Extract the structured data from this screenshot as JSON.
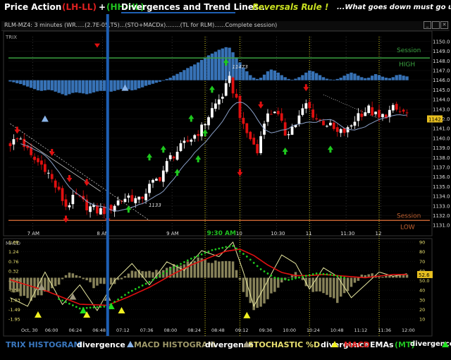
{
  "header": {
    "price_action": "Price Action",
    "lh_ll": "(LH-LL)",
    "plus": "+",
    "hh_hl": "(HH-HL)",
    "divergences": "Divergences and Trend Lines...",
    "reversals": "Reversals Rule !",
    "tagline": "...What goes down must go up"
  },
  "window": {
    "caption": "RLM-MZ4: 3 minutes (WR.....(2.7E-05,T5)...(STO+MACDx)........(TL for RLM)......Complete session)",
    "trix_label": "TRIX",
    "macd_label": "MACD"
  },
  "colors": {
    "bull": "#ffffff",
    "bear": "#e01010",
    "trix": "#3a78c0",
    "macd_hist": "#a09a6a",
    "stoch": "#e8e8a0",
    "blue_line": "#1e5fb4",
    "green": "#1ec81e",
    "red": "#e01010",
    "session_high": "#3aa040",
    "session_low": "#c06030"
  },
  "chart_data": [
    {
      "type": "candlestick",
      "name": "price",
      "y_ticks": [
        1131.0,
        1132.0,
        1133.0,
        1134.0,
        1135.0,
        1136.0,
        1137.0,
        1138.0,
        1139.0,
        1140.0,
        1141.0,
        1142.0,
        1143.0,
        1144.0,
        1145.0,
        1146.0,
        1147.0,
        1148.0,
        1149.0,
        1150.0
      ],
      "ylim": [
        1130.5,
        1150.5
      ],
      "x_labels": [
        "7 AM",
        "8 AM",
        "9 AM",
        "9:30 AM",
        "10",
        "10:30",
        "11",
        "11:30",
        "12"
      ],
      "x_label_pos": [
        6.5,
        26.5,
        46.5,
        56.5,
        66.5,
        76.5,
        86.5,
        96.5,
        106.5
      ],
      "bar_count": 115,
      "close_path": [
        [
          0,
          1139.5
        ],
        [
          3,
          1140.0
        ],
        [
          6,
          1138.0
        ],
        [
          10,
          1137.0
        ],
        [
          13,
          1135.0
        ],
        [
          16,
          1133.0
        ],
        [
          19,
          1134.0
        ],
        [
          22,
          1133.0
        ],
        [
          25,
          1132.5
        ],
        [
          28,
          1132.5
        ],
        [
          31,
          1133.5
        ],
        [
          34,
          1134.0
        ],
        [
          37,
          1133.5
        ],
        [
          40,
          1135.0
        ],
        [
          43,
          1136.0
        ],
        [
          46,
          1138.0
        ],
        [
          49,
          1139.0
        ],
        [
          52,
          1140.0
        ],
        [
          55,
          1141.0
        ],
        [
          58,
          1143.0
        ],
        [
          61,
          1144.5
        ],
        [
          63,
          1146.0
        ],
        [
          65,
          1144.0
        ],
        [
          67,
          1141.0
        ],
        [
          69,
          1140.0
        ],
        [
          71,
          1138.5
        ],
        [
          73,
          1142.0
        ],
        [
          76,
          1143.0
        ],
        [
          79,
          1140.5
        ],
        [
          82,
          1141.5
        ],
        [
          85,
          1143.5
        ],
        [
          88,
          1142.0
        ],
        [
          91,
          1141.5
        ],
        [
          94,
          1140.5
        ],
        [
          97,
          1140.8
        ],
        [
          100,
          1142.5
        ],
        [
          103,
          1143.0
        ],
        [
          106,
          1142.0
        ],
        [
          110,
          1143.0
        ],
        [
          114,
          1142.5
        ]
      ],
      "session_high": {
        "label1": "Session",
        "label2": "HIGH",
        "value": 1148.3
      },
      "session_low": {
        "label1": "Session",
        "label2": "LOW",
        "value": 1131.5
      },
      "annotations": [
        {
          "text": "11473",
          "at": 65,
          "value": 1147.2
        },
        {
          "text": "1133",
          "at": 41,
          "value": 1132.9
        }
      ],
      "last_price": "1142.0",
      "vertical_markers": [
        56,
        66,
        86,
        106
      ],
      "blue_line_at": 28,
      "signals": [
        {
          "kind": "red-down",
          "at": 2,
          "value": 1140.9
        },
        {
          "kind": "red-down",
          "at": 12,
          "value": 1138.6
        },
        {
          "kind": "red-down",
          "at": 17,
          "value": 1135.9
        },
        {
          "kind": "red-down",
          "at": 22,
          "value": 1135.5
        },
        {
          "kind": "red-down",
          "at": 16,
          "value": 1131.7
        },
        {
          "kind": "red-down",
          "at": 28,
          "value": 1131.7
        },
        {
          "kind": "green-up",
          "at": 34,
          "value": 1132.6
        },
        {
          "kind": "green-up",
          "at": 40,
          "value": 1138.0
        },
        {
          "kind": "green-up",
          "at": 44,
          "value": 1138.8
        },
        {
          "kind": "green-up",
          "at": 48,
          "value": 1136.4
        },
        {
          "kind": "green-up",
          "at": 54,
          "value": 1137.8
        },
        {
          "kind": "green-up",
          "at": 52,
          "value": 1142.0
        },
        {
          "kind": "green-up",
          "at": 56,
          "value": 1140.5
        },
        {
          "kind": "green-up",
          "at": 58,
          "value": 1145.0
        },
        {
          "kind": "green-up",
          "at": 62,
          "value": 1147.8
        },
        {
          "kind": "red-down",
          "at": 66,
          "value": 1136.5
        },
        {
          "kind": "red-down",
          "at": 72,
          "value": 1143.5
        },
        {
          "kind": "green-up",
          "at": 79,
          "value": 1138.6
        },
        {
          "kind": "red-down",
          "at": 85,
          "value": 1145.3
        },
        {
          "kind": "green-up",
          "at": 92,
          "value": 1138.8
        }
      ],
      "trix_triangles": [
        {
          "at": 10,
          "value": 1142.0
        },
        {
          "at": 33,
          "value": 1145.2
        }
      ]
    },
    {
      "type": "bar",
      "name": "TRIX histogram",
      "values": [
        -0.05,
        -0.08,
        -0.12,
        -0.15,
        -0.2,
        -0.25,
        -0.3,
        -0.35,
        -0.4,
        -0.42,
        -0.4,
        -0.38,
        -0.4,
        -0.45,
        -0.5,
        -0.55,
        -0.6,
        -0.55,
        -0.5,
        -0.48,
        -0.5,
        -0.52,
        -0.55,
        -0.52,
        -0.48,
        -0.44,
        -0.42,
        -0.42,
        -0.44,
        -0.45,
        -0.42,
        -0.38,
        -0.35,
        -0.33,
        -0.36,
        -0.4,
        -0.38,
        -0.32,
        -0.28,
        -0.22,
        -0.18,
        -0.14,
        -0.1,
        -0.06,
        -0.02,
        0.05,
        0.1,
        0.18,
        0.25,
        0.32,
        0.4,
        0.48,
        0.55,
        0.62,
        0.7,
        0.8,
        0.9,
        0.98,
        1.05,
        1.12,
        1.2,
        1.25,
        1.3,
        1.28,
        1.1,
        0.9,
        0.7,
        0.5,
        0.35,
        0.2,
        0.1,
        0.05,
        0.1,
        0.22,
        0.35,
        0.42,
        0.38,
        0.3,
        0.2,
        0.12,
        0.05,
        0.02,
        0.06,
        0.12,
        0.2,
        0.3,
        0.38,
        0.35,
        0.28,
        0.2,
        0.12,
        0.06,
        0.03,
        0.02,
        0.05,
        0.1,
        0.18,
        0.25,
        0.3,
        0.26,
        0.18,
        0.12,
        0.08,
        0.1,
        0.18,
        0.24,
        0.2,
        0.14,
        0.1,
        0.08,
        0.12,
        0.2,
        0.22,
        0.18,
        0.15
      ]
    },
    {
      "type": "line",
      "name": "MACD indicator",
      "y_ticks_left": [
        "1.68",
        "1.24",
        "0.76",
        "0.32",
        "-0.13",
        "-0.58",
        "-1.03",
        "-1.49",
        "-1.95"
      ],
      "y_ticks_right": [
        "90",
        "80",
        "70",
        "60",
        "50.0",
        "40",
        "30",
        "20",
        "10"
      ],
      "x_labels": [
        "Oct, 30",
        "06:00",
        "06:24",
        "06:48",
        "07:12",
        "07:36",
        "08:00",
        "08:24",
        "08:48",
        "09:12",
        "09:36",
        "10:00",
        "10:24",
        "10:48",
        "11:12",
        "11:36",
        "12:00"
      ],
      "ylim": [
        -1.95,
        1.68
      ],
      "histogram_anchors": [
        [
          0,
          -0.6
        ],
        [
          6,
          -1.0
        ],
        [
          12,
          -0.5
        ],
        [
          18,
          0.3
        ],
        [
          24,
          -0.4
        ],
        [
          30,
          -0.2
        ],
        [
          36,
          0.4
        ],
        [
          42,
          0.3
        ],
        [
          48,
          0.6
        ],
        [
          54,
          0.9
        ],
        [
          60,
          0.7
        ],
        [
          64,
          0.8
        ],
        [
          67,
          -0.6
        ],
        [
          70,
          -1.6
        ],
        [
          74,
          -1.0
        ],
        [
          78,
          -0.3
        ],
        [
          82,
          0.2
        ],
        [
          86,
          -0.5
        ],
        [
          90,
          -0.8
        ],
        [
          94,
          -1.1
        ],
        [
          98,
          -0.4
        ],
        [
          102,
          0.2
        ],
        [
          106,
          0.1
        ],
        [
          110,
          0.15
        ],
        [
          114,
          0.1
        ]
      ],
      "stoch_anchors": [
        [
          0,
          30
        ],
        [
          5,
          20
        ],
        [
          10,
          60
        ],
        [
          15,
          22
        ],
        [
          20,
          45
        ],
        [
          25,
          15
        ],
        [
          30,
          50
        ],
        [
          35,
          70
        ],
        [
          40,
          45
        ],
        [
          45,
          72
        ],
        [
          50,
          62
        ],
        [
          55,
          85
        ],
        [
          60,
          78
        ],
        [
          64,
          95
        ],
        [
          67,
          60
        ],
        [
          70,
          20
        ],
        [
          74,
          50
        ],
        [
          78,
          80
        ],
        [
          82,
          70
        ],
        [
          86,
          40
        ],
        [
          90,
          65
        ],
        [
          94,
          55
        ],
        [
          98,
          30
        ],
        [
          102,
          45
        ],
        [
          106,
          60
        ],
        [
          110,
          55
        ],
        [
          114,
          58
        ]
      ],
      "macd_anchors": [
        [
          0,
          -0.2
        ],
        [
          8,
          -0.5
        ],
        [
          14,
          -1.0
        ],
        [
          20,
          -1.45
        ],
        [
          28,
          -1.35
        ],
        [
          34,
          -0.7
        ],
        [
          40,
          -0.2
        ],
        [
          46,
          0.4
        ],
        [
          52,
          0.9
        ],
        [
          58,
          1.3
        ],
        [
          62,
          1.45
        ],
        [
          64,
          1.5
        ],
        [
          68,
          1.0
        ],
        [
          72,
          0.4
        ],
        [
          76,
          0.0
        ],
        [
          80,
          -0.1
        ],
        [
          84,
          0.05
        ],
        [
          88,
          0.2
        ],
        [
          92,
          0.15
        ],
        [
          96,
          0.0
        ],
        [
          100,
          -0.05
        ],
        [
          104,
          0.05
        ],
        [
          108,
          0.2
        ],
        [
          114,
          0.15
        ]
      ],
      "signal_anchors": [
        [
          0,
          -0.1
        ],
        [
          10,
          -0.6
        ],
        [
          20,
          -1.25
        ],
        [
          28,
          -1.3
        ],
        [
          34,
          -0.9
        ],
        [
          40,
          -0.45
        ],
        [
          46,
          0.1
        ],
        [
          52,
          0.6
        ],
        [
          58,
          1.0
        ],
        [
          62,
          1.25
        ],
        [
          66,
          1.35
        ],
        [
          70,
          1.05
        ],
        [
          74,
          0.6
        ],
        [
          78,
          0.25
        ],
        [
          82,
          0.1
        ],
        [
          86,
          0.1
        ],
        [
          90,
          0.15
        ],
        [
          94,
          0.1
        ],
        [
          98,
          0.05
        ],
        [
          102,
          0.0
        ],
        [
          106,
          0.08
        ],
        [
          110,
          0.15
        ],
        [
          114,
          0.15
        ]
      ],
      "last_value": "52.6",
      "triangles": [
        {
          "kind": "yellow",
          "at": 8,
          "value": -1.75
        },
        {
          "kind": "gray",
          "at": 9,
          "value": -0.45
        },
        {
          "kind": "gray",
          "at": 18,
          "value": -0.9
        },
        {
          "kind": "green",
          "at": 21,
          "value": -1.55
        },
        {
          "kind": "yellow",
          "at": 22,
          "value": -1.75
        },
        {
          "kind": "gray",
          "at": 28,
          "value": -0.95
        },
        {
          "kind": "green",
          "at": 29,
          "value": -1.35
        },
        {
          "kind": "yellow",
          "at": 32,
          "value": -1.55
        },
        {
          "kind": "yellow",
          "at": 68,
          "value": -1.78
        }
      ]
    }
  ],
  "footer": {
    "trix": "TRIX HISTOGRAM",
    "macd_hist": "MACD HISTOGRAM",
    "stoch": "STOCHASTIC %D",
    "macd": "MACD",
    "emas": "EMAs",
    "mt": "(MT)",
    "divergence": "divergence"
  }
}
